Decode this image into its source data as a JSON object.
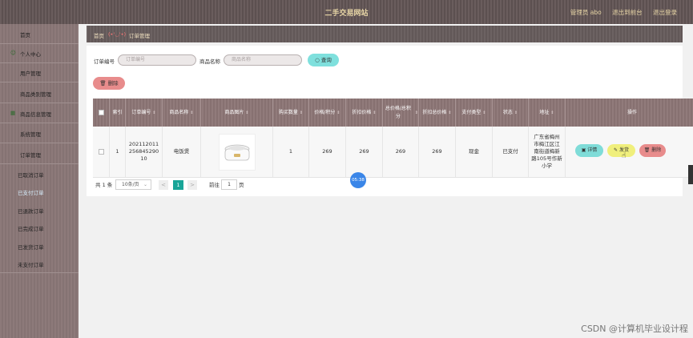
{
  "header": {
    "title": "二手交易网站",
    "admin_label": "管理员 abo",
    "back_label": "退出到前台",
    "logout_label": "退出登录"
  },
  "sidebar": {
    "items": [
      {
        "label": "首页"
      },
      {
        "label": "个人中心"
      },
      {
        "label": "用户管理"
      },
      {
        "label": "商品类别管理"
      },
      {
        "label": "商品信息管理"
      },
      {
        "label": "系统管理"
      },
      {
        "label": "订单管理"
      }
    ],
    "sub_items": [
      {
        "label": "已取消订单"
      },
      {
        "label": "已支付订单"
      },
      {
        "label": "已退款订单"
      },
      {
        "label": "已完成订单"
      },
      {
        "label": "已发货订单"
      },
      {
        "label": "未支付订单"
      }
    ]
  },
  "breadcrumb": {
    "home": "首页",
    "emoticon": "(•'◡'•)",
    "current": "订单管理"
  },
  "search": {
    "order_label": "订单编号",
    "order_placeholder": "订单编号",
    "product_label": "商品名称",
    "product_placeholder": "商品名称",
    "search_button": "查询"
  },
  "delete_button": "删除",
  "table": {
    "headers": [
      "索引",
      "订单编号",
      "商品名称",
      "商品图片",
      "购买数量",
      "价格/积分",
      "折扣价格",
      "总价格/总积分",
      "折扣总价格",
      "支付类型",
      "状态",
      "地址",
      "操作"
    ],
    "row": {
      "index": "1",
      "order_no": "2021120112568452 9010",
      "order_lines": [
        "202112011",
        "256845290",
        "10"
      ],
      "product_name": "电饭煲",
      "quantity": "1",
      "price": "269",
      "discount_price": "269",
      "total": "269",
      "discount_total": "269",
      "pay_type": "现金",
      "status": "已支付",
      "address_lines": [
        "广东省梅州",
        "市梅江区江",
        "南街道梅新",
        "路105号作新",
        "小学"
      ],
      "actions": {
        "detail": "详情",
        "ship": "发货",
        "delete": "删除"
      }
    }
  },
  "pagination": {
    "total": "共 1 条",
    "page_size": "10条/页",
    "prev": "<",
    "page": "1",
    "next": ">",
    "goto_label": "前往",
    "goto_value": "1",
    "page_suffix": "页"
  },
  "timer": "05:38",
  "watermark": "CSDN @计算机毕业设计程",
  "colors": {
    "topbar": "#5c5050",
    "sidebar": "#8a7676",
    "table_header": "#8c7676",
    "search_button": "#7fe0dd",
    "delete_button": "#e88c8c",
    "detail_button": "#7fdcd8",
    "ship_button": "#f0ef7c",
    "active_page": "#19a598"
  }
}
